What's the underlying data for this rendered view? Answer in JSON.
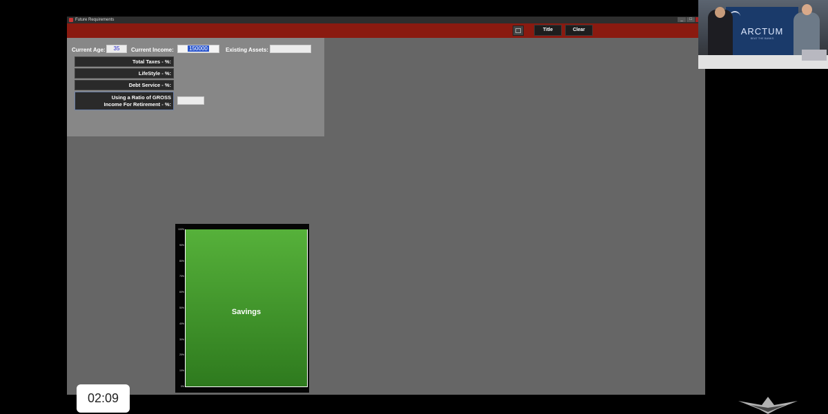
{
  "window": {
    "title": "Future Requirements",
    "controls": {
      "minimize": "_",
      "maximize": "□",
      "close": "x"
    }
  },
  "toolbar": {
    "icon": "table-icon",
    "title_label": "Title",
    "clear_label": "Clear"
  },
  "inputs": {
    "current_age_label": "Current Age:",
    "current_age_value": "35",
    "current_income_label": "Current Income:",
    "current_income_value": "150000",
    "existing_assets_label": "Existing Assets:",
    "existing_assets_value": "",
    "total_taxes_label": "Total Taxes - %:",
    "lifestyle_label": "LifeStyle - %:",
    "debt_service_label": "Debt Service - %:",
    "ratio_label": "Using a Ratio of GROSS Income For Retirement - %:",
    "ratio_value": ""
  },
  "chart_data": {
    "type": "bar",
    "categories": [
      "Savings"
    ],
    "values": [
      100
    ],
    "ylim": [
      0,
      100
    ],
    "yticks": [
      "0%",
      "10%",
      "20%",
      "30%",
      "40%",
      "50%",
      "60%",
      "70%",
      "80%",
      "90%",
      "100%"
    ],
    "colors": {
      "bar": "#3f9a2a",
      "background": "#050505"
    }
  },
  "timer": {
    "text": "02:09"
  },
  "colors": {
    "accent": "#8a1a10",
    "window_bg": "#666666",
    "panel_bg": "#878787"
  },
  "webcam": {
    "screen_text": "ARCTUM",
    "screen_subtext": "BEAT THE BANKS"
  }
}
